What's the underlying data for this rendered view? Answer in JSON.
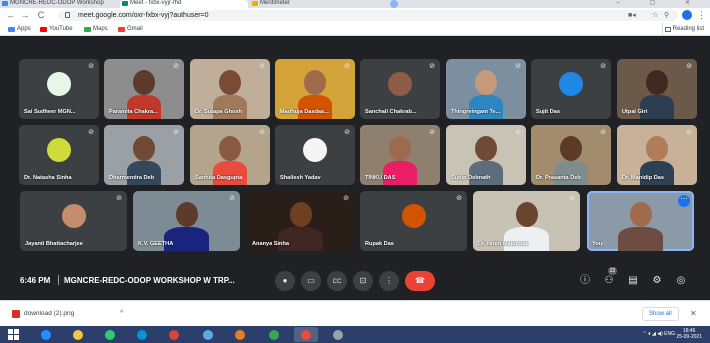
{
  "browser": {
    "tabs": [
      {
        "label": "MGNCRE-REDC-ODOP Workshop",
        "color": "#4285f4"
      },
      {
        "label": "Meet - fxbx-vyjr-fhd",
        "color": "#00897b"
      },
      {
        "label": "Mentimeter",
        "color": "#f9ab00"
      }
    ],
    "window_controls": "– ▢ ✕",
    "url": "meet.google.com/oxr-fxbx-vyj?authuser=0",
    "back": "←",
    "forward": "→",
    "reload": "C",
    "bookmarks": [
      {
        "label": "Apps",
        "color": "#4285f4"
      },
      {
        "label": "YouTube",
        "color": "#ff0000"
      },
      {
        "label": "Maps",
        "color": "#34a853"
      },
      {
        "label": "Gmail",
        "color": "#ea4335"
      }
    ],
    "reading_list": "Reading list",
    "menu": "⋮"
  },
  "meet": {
    "mic_off_symbol": "⊘",
    "participants": [
      {
        "name": "Sai Sudheer MGN...",
        "bg": "#3c4043",
        "avatar": "#e8f5e9",
        "type": "avatar"
      },
      {
        "name": "Paramita Chakra...",
        "bg": "#8d8d8d",
        "type": "photo",
        "skin": "#5d3a2a",
        "cloth": "#c0392b"
      },
      {
        "name": "Dr. Sutapa Ghosh",
        "bg": "#bfae9a",
        "type": "photo",
        "skin": "#7a4b34",
        "cloth": "#a0785a"
      },
      {
        "name": "Madhuja Dasdas...",
        "bg": "#d4a33a",
        "type": "photo",
        "skin": "#a06b4c",
        "cloth": "#d35400"
      },
      {
        "name": "Sanchali Chakrab...",
        "bg": "#3c4043",
        "avatar": "#8e5b46",
        "type": "avatar"
      },
      {
        "name": "Thingreingam Te...",
        "bg": "#7b8fa1",
        "type": "photo",
        "skin": "#c49a78",
        "cloth": "#2e86c1"
      },
      {
        "name": "Sujit Das",
        "bg": "#3c4043",
        "avatar": "#1e88e5",
        "type": "avatar"
      },
      {
        "name": "Utpal Giri",
        "bg": "#6b5a4a",
        "type": "photo",
        "skin": "#3f2a20",
        "cloth": "#2c3e50"
      },
      {
        "name": "Dr. Natasha Sinha",
        "bg": "#3c4043",
        "avatar": "#cddc39",
        "type": "avatar"
      },
      {
        "name": "Dharmendra Deb",
        "bg": "#9aa0a6",
        "type": "photo",
        "skin": "#6f4a35",
        "cloth": "#34495e"
      },
      {
        "name": "Sanhita Dasgupta",
        "bg": "#b5a48c",
        "type": "photo",
        "skin": "#8a5a40",
        "cloth": "#e74c3c"
      },
      {
        "name": "Shailesh Yadav",
        "bg": "#3c4043",
        "avatar": "#f5f5f5",
        "type": "avatar"
      },
      {
        "name": "TINKU DAS",
        "bg": "#8f7f6f",
        "type": "photo",
        "skin": "#9c6a4c",
        "cloth": "#e91e63"
      },
      {
        "name": "Sudip Debnath",
        "bg": "#c9c3b5",
        "type": "photo",
        "skin": "#6f4a35",
        "cloth": "#5d6d7e"
      },
      {
        "name": "Dr. Prasanta Deb",
        "bg": "#a38b6d",
        "type": "photo",
        "skin": "#5b3a28",
        "cloth": "#7f8c8d"
      },
      {
        "name": "Dr. Manidip Das",
        "bg": "#c7b299",
        "type": "photo",
        "skin": "#b07c5a",
        "cloth": "#2e4053"
      },
      {
        "name": "Jayanti Bhattacharjee",
        "bg": "#3c4043",
        "avatar": "#c58c6e",
        "type": "avatar"
      },
      {
        "name": "K.V. GEETHA",
        "bg": "#7c8b94",
        "type": "photo",
        "skin": "#5d3a2a",
        "cloth": "#1a237e"
      },
      {
        "name": "Ananya Sinha",
        "bg": "#2a1f18",
        "type": "photo",
        "skin": "#6e3f22",
        "cloth": "#3e2723"
      },
      {
        "name": "Rupak Das",
        "bg": "#3c4043",
        "avatar": "#d35400",
        "type": "avatar"
      },
      {
        "name": "Dr. Niren Majumdar",
        "bg": "#c8c2b4",
        "type": "photo",
        "skin": "#6a4530",
        "cloth": "#ecf0f1"
      },
      {
        "name": "You",
        "bg": "#8c9aa8",
        "type": "photo",
        "skin": "#a06b4c",
        "cloth": "#6d4c41",
        "more": "⋯"
      }
    ],
    "time": "6:46 PM",
    "meeting_title": "MGNCRE-REDC-ODOP WORKSHOP W TRP...",
    "controls": [
      {
        "name": "mic",
        "symbol": "🎤"
      },
      {
        "name": "camera",
        "symbol": "▭"
      },
      {
        "name": "captions",
        "symbol": "CC"
      },
      {
        "name": "present",
        "symbol": "⊡"
      },
      {
        "name": "more",
        "symbol": "⋮"
      },
      {
        "name": "end-call",
        "symbol": "☎"
      }
    ],
    "right_controls": [
      {
        "name": "info",
        "symbol": "ⓘ"
      },
      {
        "name": "people",
        "symbol": "⚇",
        "badge": "22"
      },
      {
        "name": "chat",
        "symbol": "▤"
      },
      {
        "name": "activities",
        "symbol": "⚙"
      },
      {
        "name": "host",
        "symbol": "◎"
      }
    ]
  },
  "downloads": {
    "file": "download (2).png",
    "chevron": "^",
    "show_all": "Show all",
    "close": "✕"
  },
  "taskbar": {
    "apps": [
      {
        "name": "ie",
        "color": "#1e90ff"
      },
      {
        "name": "explorer",
        "color": "#f4c542"
      },
      {
        "name": "media",
        "color": "#2ecc71"
      },
      {
        "name": "hp",
        "color": "#0096d6"
      },
      {
        "name": "chrome",
        "color": "#db4437"
      },
      {
        "name": "files",
        "color": "#5dade2"
      },
      {
        "name": "firefox",
        "color": "#e67e22"
      },
      {
        "name": "chrome2",
        "color": "#34a853"
      },
      {
        "name": "paint",
        "color": "#e74c3c"
      },
      {
        "name": "other",
        "color": "#95a5a6"
      }
    ],
    "tray_icons": "⌃ ♦ ◢ ◀) ENG",
    "time": "18:46",
    "date": "25-09-2021"
  }
}
